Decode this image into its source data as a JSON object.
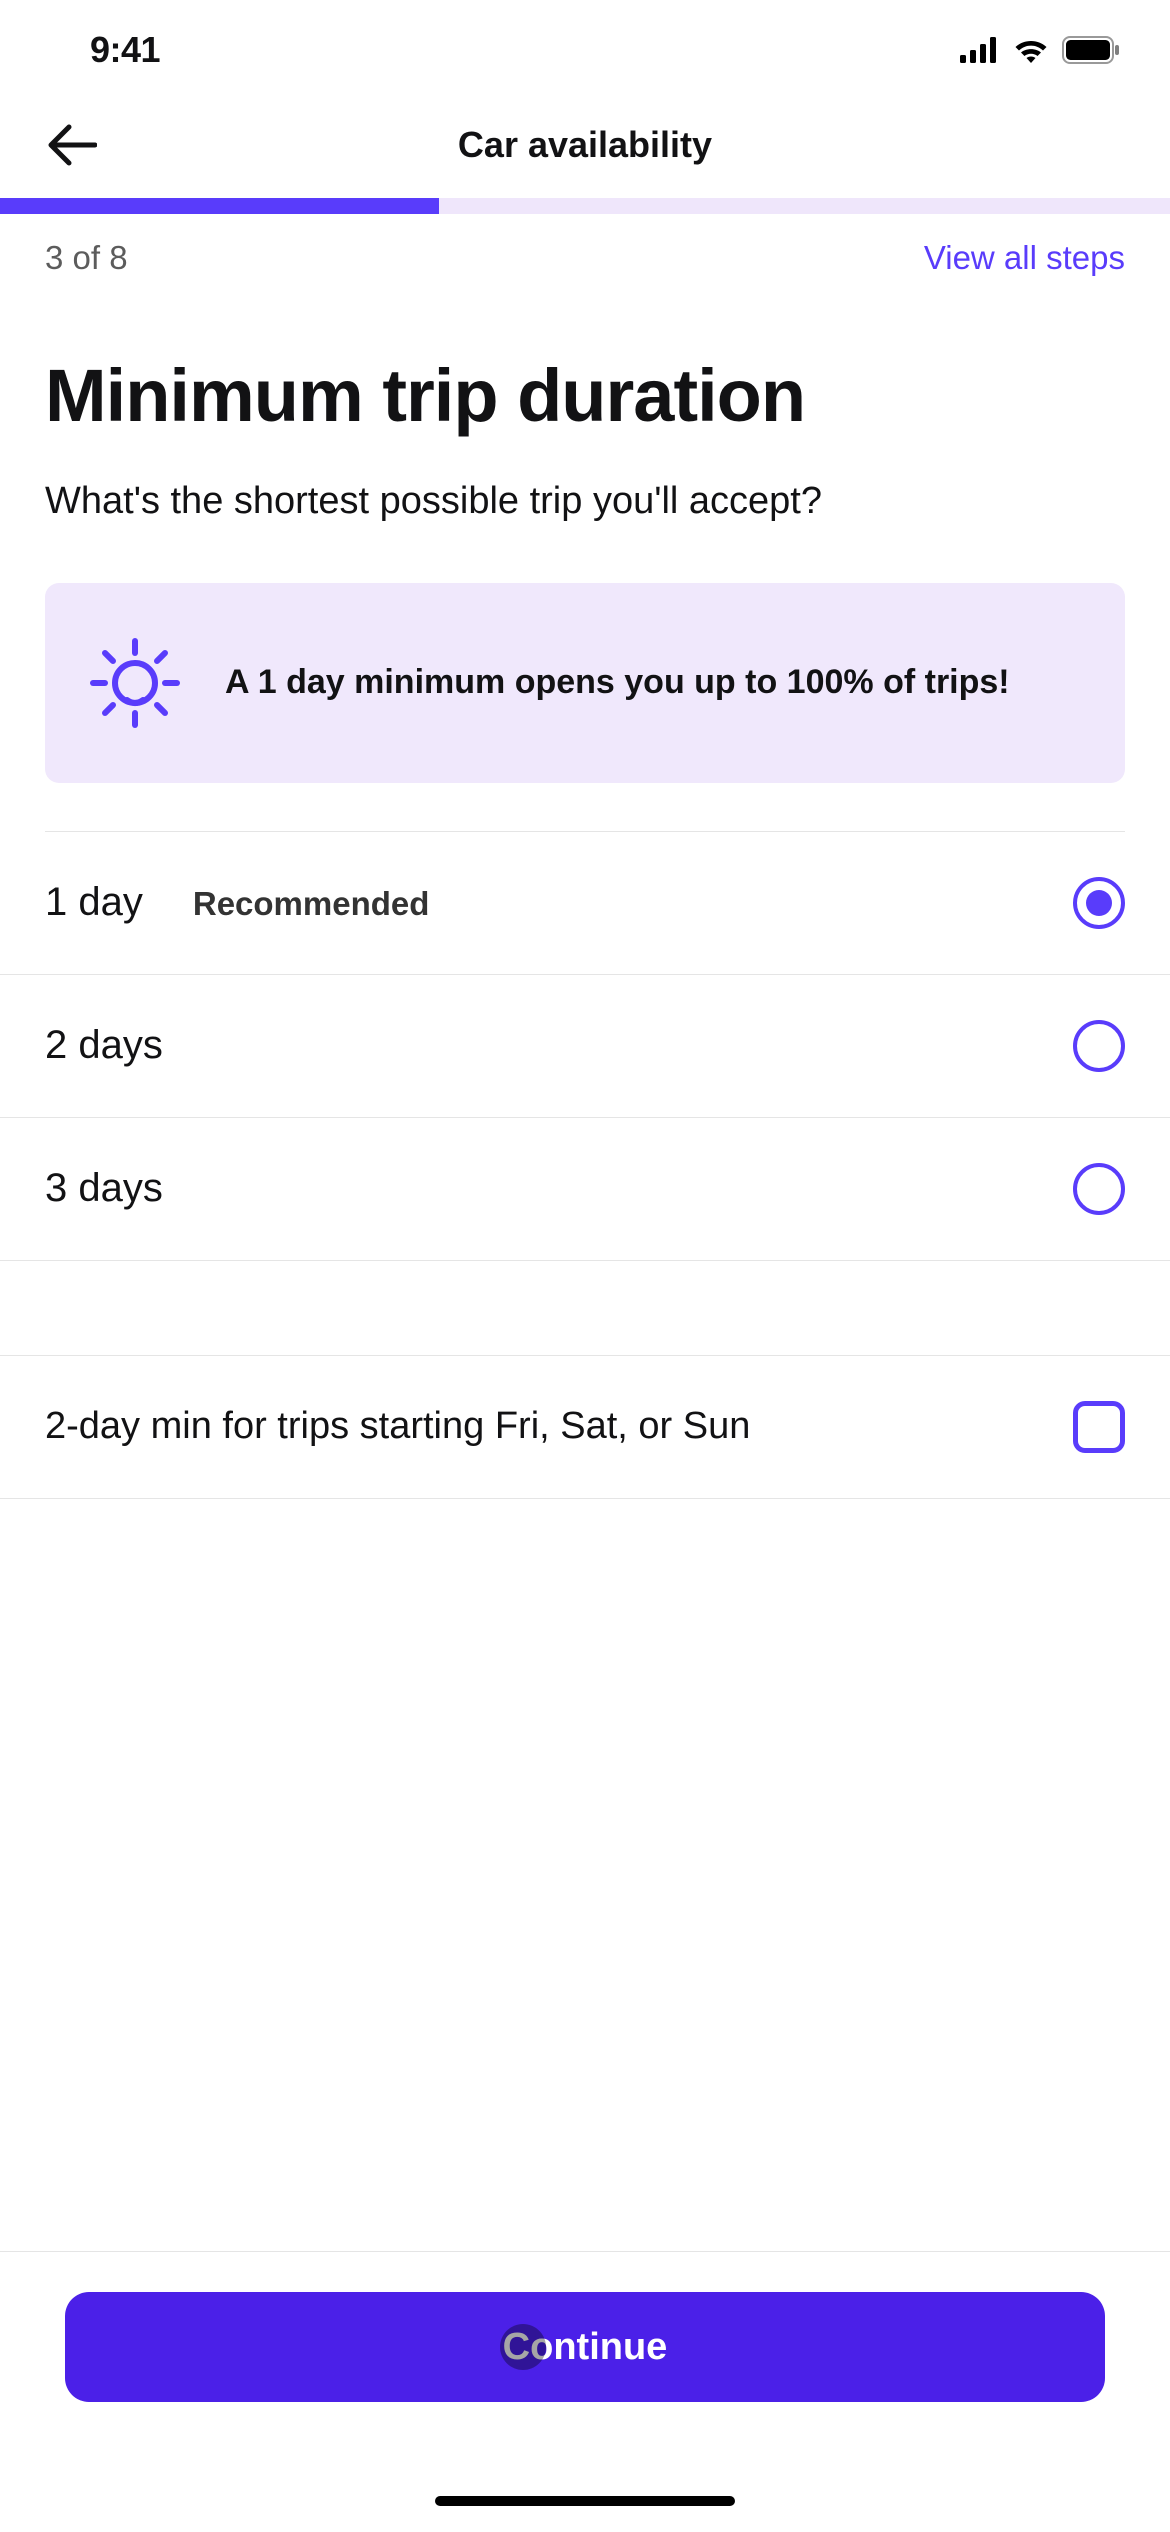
{
  "status": {
    "time": "9:41"
  },
  "nav": {
    "title": "Car availability"
  },
  "progress": {
    "step_label": "3 of 8",
    "view_all": "View all steps"
  },
  "page": {
    "heading": "Minimum trip duration",
    "subheading": "What's the shortest possible trip you'll accept?"
  },
  "info": {
    "text": "A 1 day minimum opens you up to 100% of trips!"
  },
  "options": [
    {
      "label": "1 day",
      "tag": "Recommended",
      "selected": true
    },
    {
      "label": "2 days",
      "tag": "",
      "selected": false
    },
    {
      "label": "3 days",
      "tag": "",
      "selected": false
    }
  ],
  "weekend": {
    "label": "2-day min for trips starting Fri, Sat, or Sun",
    "checked": false
  },
  "footer": {
    "continue": "Continue"
  }
}
